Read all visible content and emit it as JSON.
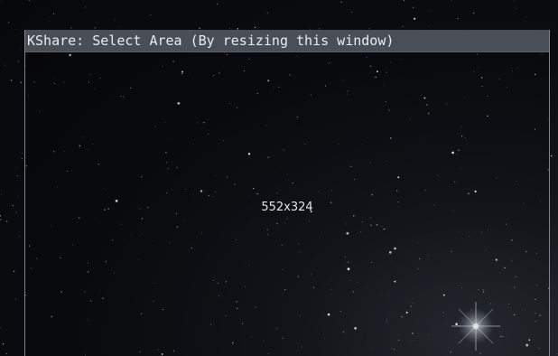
{
  "window": {
    "title": "KShare: Select Area (By resizing this window)",
    "size_label": "552x324"
  },
  "colors": {
    "title_bar": "#4a4f57",
    "frame_border": "#7d838c",
    "title_text": "#e9ebee"
  },
  "icons": {
    "background": "starfield-wallpaper",
    "flare": "star-flare"
  }
}
